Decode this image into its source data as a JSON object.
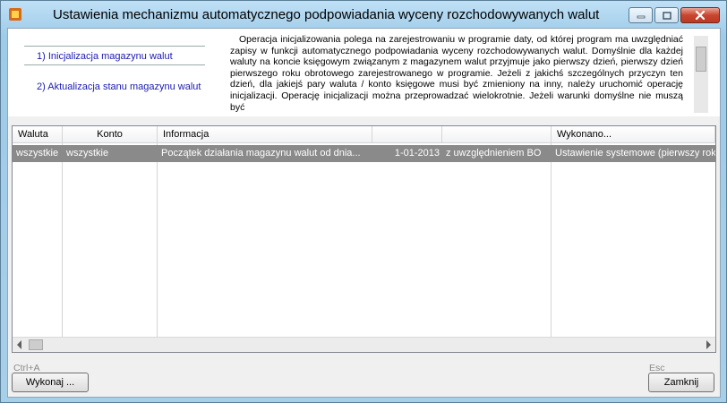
{
  "window": {
    "title": "Ustawienia mechanizmu automatycznego podpowiadania wyceny rozchodowywanych walut"
  },
  "steps": [
    {
      "label": "1) Inicjalizacja magazynu walut",
      "active": true
    },
    {
      "label": "2) Aktualizacja stanu magazynu walut",
      "active": false
    }
  ],
  "description": "Operacja inicjalizowania polega na zarejestrowaniu w programie daty, od której program ma uwzględniać zapisy w funkcji automatycznego podpowiadania wyceny rozchodowywanych walut. Domyślnie dla każdej waluty na koncie księgowym związanym z magazynem walut przyjmuje jako pierwszy dzień, pierwszy dzień pierwszego roku obrotowego zarejestrowanego w programie. Jeżeli z jakichś szczególnych przyczyn ten dzień, dla jakiejś pary waluta / konto księgowe musi być zmieniony na inny, należy uruchomić operację inicjalizacji. Operację inicjalizacji można przeprowadzać wielokrotnie. Jeżeli warunki domyślne nie muszą być",
  "grid": {
    "columns": [
      "Waluta",
      "Konto",
      "Informacja",
      "",
      "",
      "Wykonano..."
    ],
    "rows": [
      {
        "waluta": "wszystkie",
        "konto": "wszystkie",
        "informacja": "Początek działania magazynu walut od dnia...",
        "data": "1-01-2013",
        "bo": "z uwzględnieniem BO",
        "wykonano": "Ustawienie systemowe (pierwszy rok c"
      }
    ]
  },
  "footer": {
    "execute_shortcut": "Ctrl+A",
    "execute_label": "Wykonaj ...",
    "close_shortcut": "Esc",
    "close_label": "Zamknij"
  },
  "icons": {
    "app": "app-icon",
    "minimize": "minimize-icon",
    "maximize": "maximize-icon",
    "close": "close-icon"
  },
  "colors": {
    "link": "#1a1ab0",
    "selected_row": "#8a8a8a",
    "close_button": "#c9452f"
  }
}
